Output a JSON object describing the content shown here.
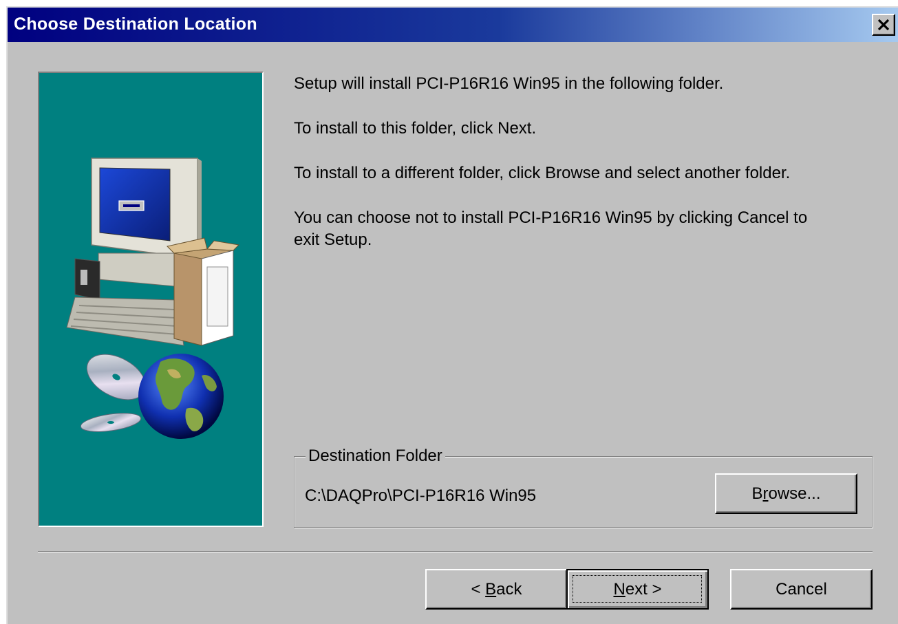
{
  "window": {
    "title": "Choose Destination Location",
    "close_glyph": "✕"
  },
  "instructions": {
    "line1": "Setup will install PCI-P16R16 Win95 in the following folder.",
    "line2": "To install to this folder, click Next.",
    "line3": "To install to a different folder, click Browse and select another folder.",
    "line4a": "You can choose not to install PCI-P16R16 Win95 by clicking Cancel to",
    "line4b": "exit Setup."
  },
  "destination": {
    "group_label": "Destination Folder",
    "path": "C:\\DAQPro\\PCI-P16R16 Win95",
    "browse_pre": "B",
    "browse_key": "r",
    "browse_post": "owse..."
  },
  "buttons": {
    "back_arrow": "<",
    "back_key": "B",
    "back_post": "ack",
    "next_key": "N",
    "next_post": "ext",
    "next_arrow": ">",
    "cancel": "Cancel"
  },
  "colors": {
    "title_gradient_start": "#000080",
    "title_gradient_end": "#a6caf0",
    "dialog_face": "#c0c0c0",
    "art_background": "#008080"
  },
  "icons": [
    "close-icon",
    "computer-icon",
    "software-box-icon",
    "cd-disc-icon",
    "globe-icon"
  ]
}
